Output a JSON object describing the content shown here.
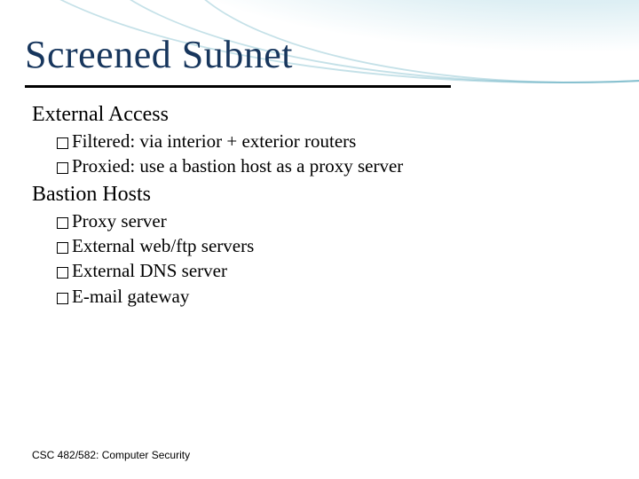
{
  "title": "Screened Subnet",
  "sections": [
    {
      "heading": "External Access",
      "items": [
        "Filtered: via interior + exterior routers",
        "Proxied: use a bastion host as a proxy server"
      ]
    },
    {
      "heading": "Bastion Hosts",
      "items": [
        "Proxy server",
        "External web/ftp servers",
        "External DNS server",
        "E-mail gateway"
      ]
    }
  ],
  "footer": "CSC 482/582: Computer Security"
}
